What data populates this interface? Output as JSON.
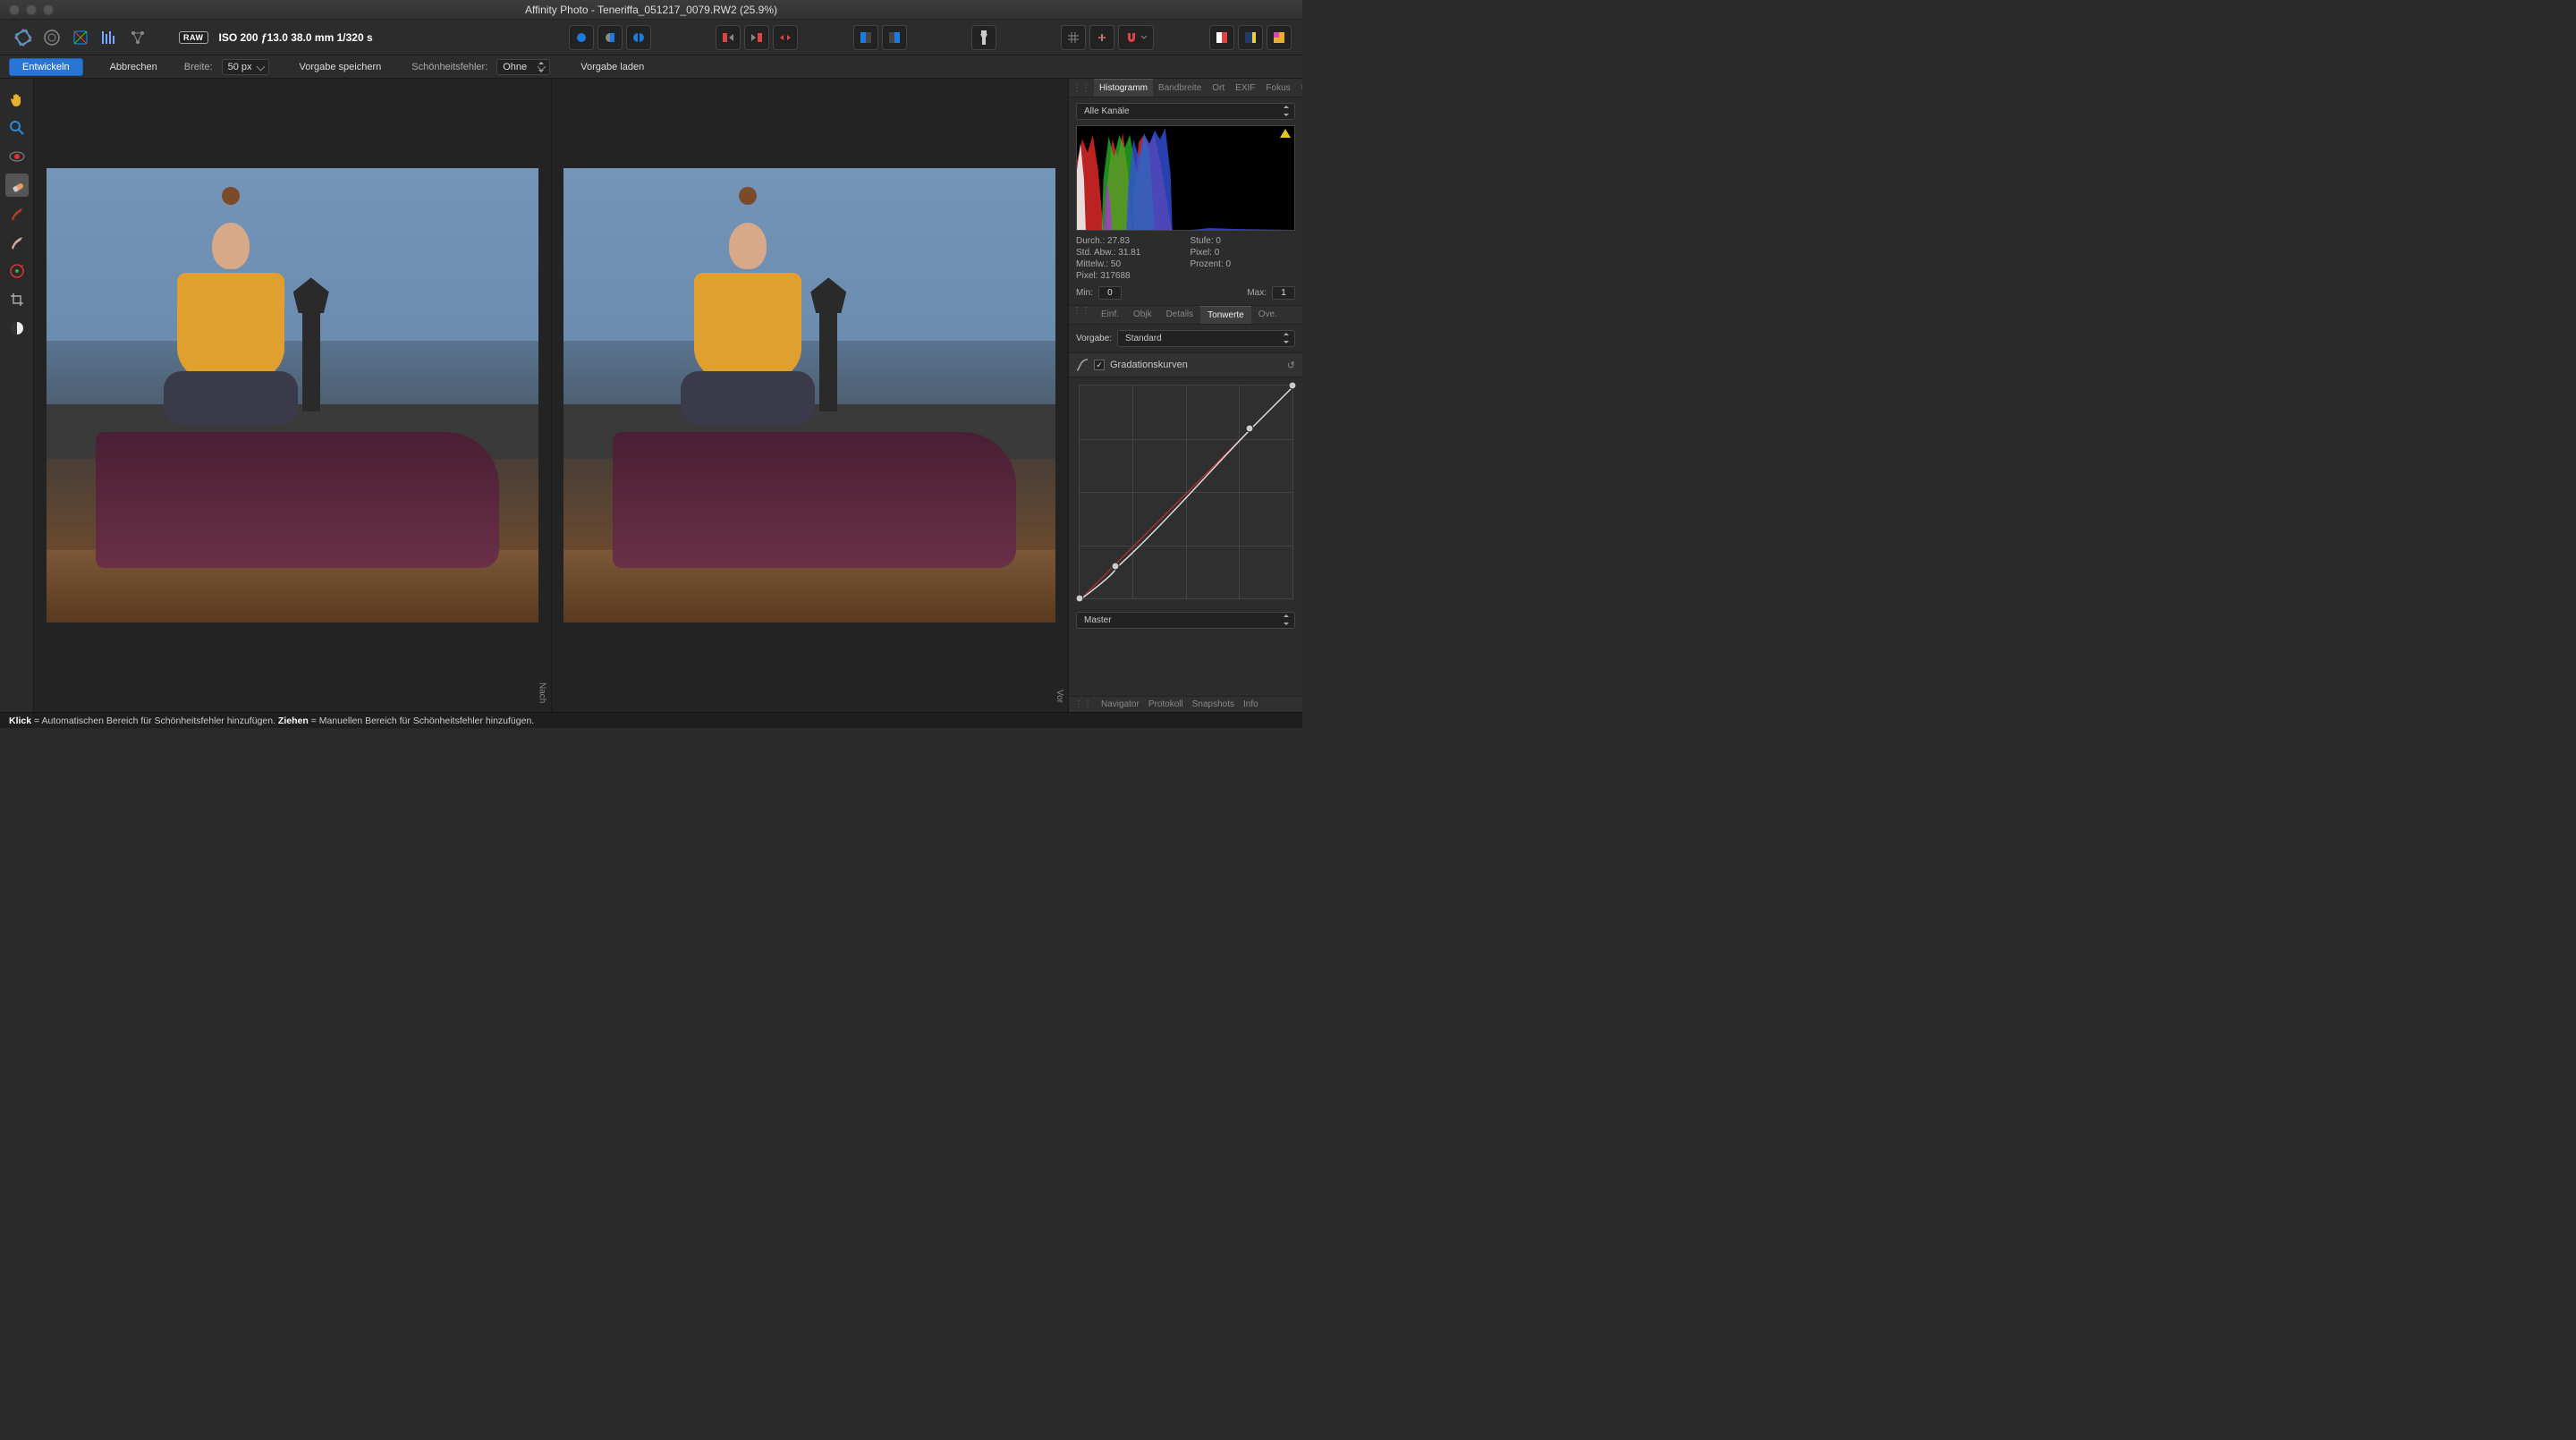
{
  "window": {
    "title": "Affinity Photo - Teneriffa_051217_0079.RW2 (25.9%)"
  },
  "toolbar": {
    "raw_badge": "RAW",
    "exif": "ISO 200 ƒ13.0 38.0 mm 1/320 s"
  },
  "options": {
    "develop": "Entwickeln",
    "cancel": "Abbrechen",
    "width_label": "Breite:",
    "width_value": "50 px",
    "save_preset": "Vorgabe speichern",
    "blemish_label": "Schönheitsfehler:",
    "blemish_value": "Ohne",
    "load_preset": "Vorgabe laden"
  },
  "viewer": {
    "after": "Nach",
    "before": "Vor"
  },
  "panel": {
    "tabs": [
      "Histogramm",
      "Bandbreite",
      "Ort",
      "EXIF",
      "Fokus"
    ],
    "tabs_active": 0,
    "channel": "Alle Kanäle",
    "stats": {
      "durch": "Durch.: 27.83",
      "stdabw": "Std. Abw.: 31.81",
      "mittelw": "Mittelw.: 50",
      "pixel": "Pixel: 317688",
      "stufe": "Stufe: 0",
      "pixel0": "Pixel: 0",
      "prozent": "Prozent: 0"
    },
    "min_label": "Min:",
    "min_value": "0",
    "max_label": "Max:",
    "max_value": "1",
    "dev_tabs": [
      "Einf.",
      "Objk",
      "Details",
      "Tonwerte",
      "Ove."
    ],
    "dev_active": 3,
    "preset_label": "Vorgabe:",
    "preset_value": "Standard",
    "section_curves": "Gradationskurven",
    "curve_channel": "Master",
    "bottom_tabs": [
      "Navigator",
      "Protokoll",
      "Snapshots",
      "Info"
    ]
  },
  "status": {
    "click_b": "Klick",
    "click_t": " = Automatischen Bereich für Schönheitsfehler hinzufügen. ",
    "drag_b": "Ziehen",
    "drag_t": " = Manuellen Bereich für Schönheitsfehler hinzufügen."
  },
  "chart_data": {
    "type": "line",
    "title": "Gradationskurven",
    "xlabel": "",
    "ylabel": "",
    "xlim": [
      0,
      1
    ],
    "ylim": [
      0,
      1
    ],
    "series": [
      {
        "name": "Master",
        "points": [
          [
            0.0,
            0.0
          ],
          [
            0.17,
            0.15
          ],
          [
            0.8,
            0.8
          ],
          [
            1.0,
            1.0
          ]
        ]
      }
    ]
  }
}
